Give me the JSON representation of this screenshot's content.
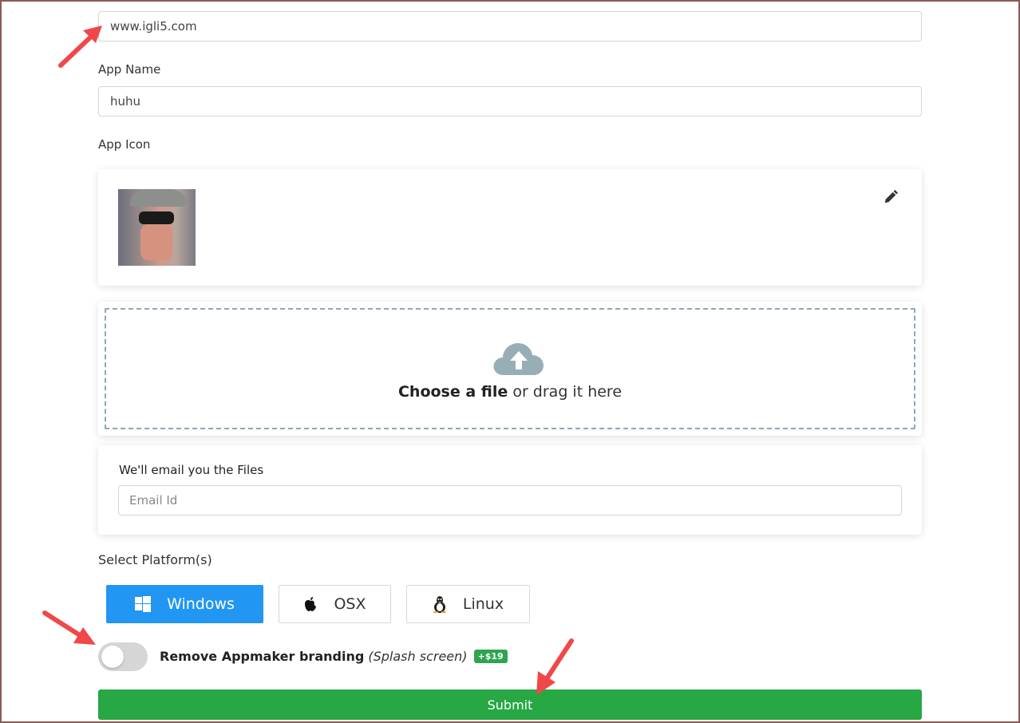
{
  "url_field": {
    "value": "www.igli5.com"
  },
  "app_name": {
    "label": "App Name",
    "value": "huhu"
  },
  "app_icon": {
    "label": "App Icon"
  },
  "dropzone": {
    "choose": "Choose a file",
    "rest": " or drag it here"
  },
  "email": {
    "label": "We'll email you the Files",
    "placeholder": "Email Id"
  },
  "platforms": {
    "label": "Select Platform(s)",
    "items": [
      {
        "label": "Windows",
        "icon": "windows-icon",
        "selected": true
      },
      {
        "label": "OSX",
        "icon": "apple-icon",
        "selected": false
      },
      {
        "label": "Linux",
        "icon": "linux-icon",
        "selected": false
      }
    ]
  },
  "branding": {
    "label": "Remove Appmaker branding",
    "note": "(Splash screen)",
    "price": "+$19",
    "enabled": false
  },
  "submit": {
    "label": "Submit"
  },
  "colors": {
    "primary": "#2196f3",
    "success": "#28a745",
    "annotation_arrow": "#f04848"
  }
}
